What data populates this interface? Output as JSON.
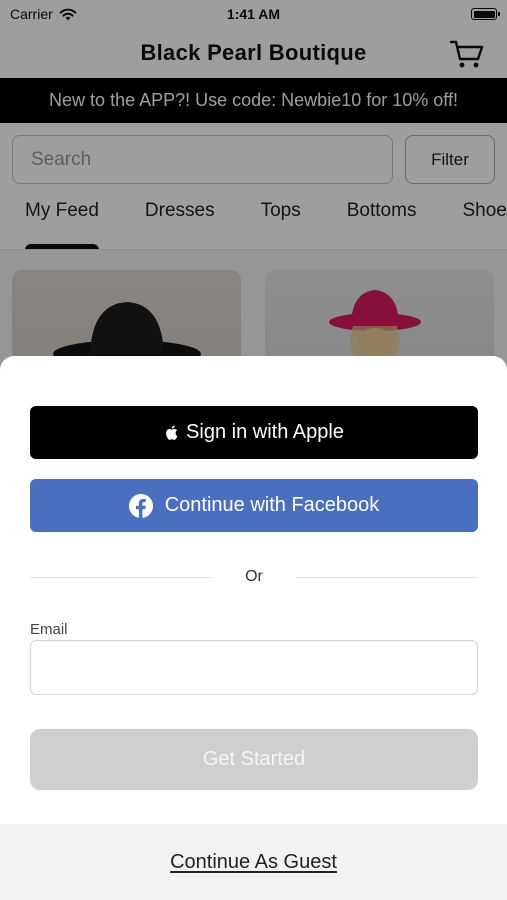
{
  "status_bar": {
    "carrier": "Carrier",
    "time": "1:41 AM"
  },
  "header": {
    "title": "Black Pearl Boutique"
  },
  "promo": {
    "text": "New to the APP?! Use code: Newbie10 for 10% off!"
  },
  "search": {
    "placeholder": "Search",
    "filter_label": "Filter"
  },
  "tabs": [
    {
      "label": "My Feed"
    },
    {
      "label": "Dresses"
    },
    {
      "label": "Tops"
    },
    {
      "label": "Bottoms"
    },
    {
      "label": "Shoes"
    }
  ],
  "login_sheet": {
    "apple_label": "Sign in with Apple",
    "facebook_label": "Continue with Facebook",
    "divider_text": "Or",
    "email_label": "Email",
    "email_value": "",
    "get_started_label": "Get Started",
    "guest_label": "Continue As Guest"
  },
  "colors": {
    "facebook_blue": "#4a6fbf",
    "apple_black": "#000000",
    "disabled_gray": "#cfcfcf",
    "hat_pink": "#d81b60"
  },
  "icons": [
    "wifi-icon",
    "battery-icon",
    "cart-icon",
    "apple-logo-icon",
    "facebook-logo-icon"
  ]
}
